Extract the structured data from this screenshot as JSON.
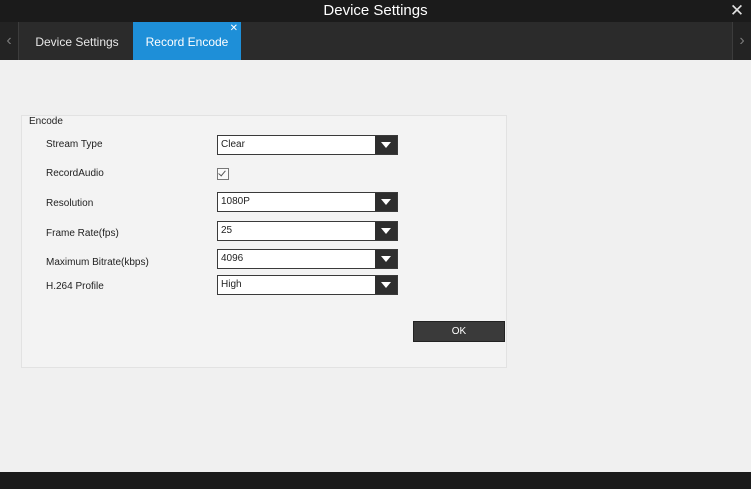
{
  "window": {
    "title": "Device Settings",
    "close_icon": "close-icon"
  },
  "tabs": [
    {
      "label": "Device Settings",
      "active": false
    },
    {
      "label": "Record Encode",
      "active": true
    }
  ],
  "tab_scroll": {
    "left": "‹",
    "right": "›"
  },
  "encode": {
    "group_title": "Encode",
    "stream_type": {
      "label": "Stream Type",
      "value": "Clear"
    },
    "record_audio": {
      "label": "RecordAudio",
      "checked": true
    },
    "resolution": {
      "label": "Resolution",
      "value": "1080P"
    },
    "frame_rate": {
      "label": "Frame Rate(fps)",
      "value": "25"
    },
    "max_bitrate": {
      "label": "Maximum Bitrate(kbps)",
      "value": "4096"
    },
    "h264_profile": {
      "label": "H.264 Profile",
      "value": "High"
    }
  },
  "buttons": {
    "ok": "OK"
  },
  "colors": {
    "active_tab": "#1e8fd8",
    "titlebar": "#1b1b1b"
  }
}
